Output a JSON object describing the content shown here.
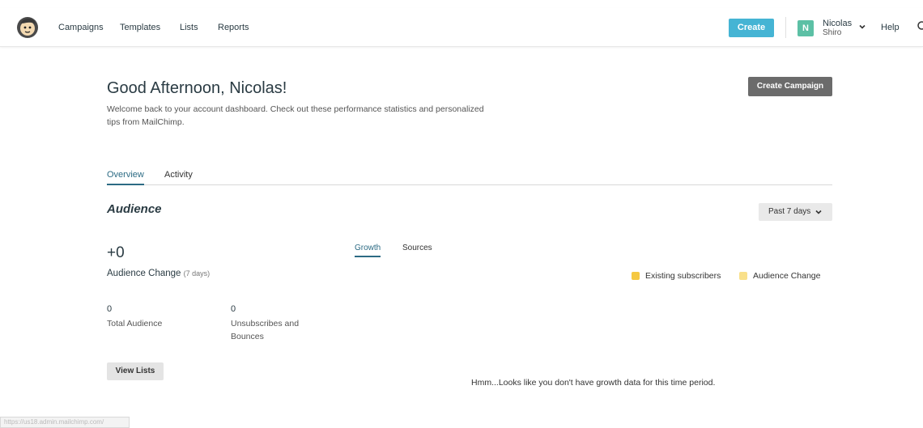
{
  "nav": {
    "items": [
      "Campaigns",
      "Templates",
      "Lists",
      "Reports"
    ],
    "create_label": "Create",
    "user_initial": "N",
    "user_first": "Nicolas",
    "user_last": "Shiro",
    "help_label": "Help"
  },
  "header": {
    "greeting": "Good Afternoon, Nicolas!",
    "welcome": "Welcome back to your account dashboard. Check out these performance statistics and personalized tips from MailChimp.",
    "create_campaign_label": "Create Campaign"
  },
  "tabs": [
    {
      "label": "Overview",
      "active": true
    },
    {
      "label": "Activity",
      "active": false
    }
  ],
  "audience": {
    "title": "Audience",
    "period": "Past 7 days",
    "change_value": "+0",
    "change_label": "Audience Change",
    "change_sub": "(7 days)",
    "total_value": "0",
    "total_label": "Total Audience",
    "unsub_value": "0",
    "unsub_label": "Unsubscribes and Bounces",
    "view_lists_label": "View Lists",
    "subtabs": [
      {
        "label": "Growth",
        "active": true
      },
      {
        "label": "Sources",
        "active": false
      }
    ],
    "legend": [
      {
        "label": "Existing subscribers",
        "color": "#f5c842"
      },
      {
        "label": "Audience Change",
        "color": "#f9e08a"
      }
    ],
    "empty_message": "Hmm...Looks like you don't have growth data for this time period."
  },
  "status_bar": {
    "url": "https://us18.admin.mailchimp.com/"
  },
  "colors": {
    "accent": "#45b4d4",
    "tab_active": "#2c6b84",
    "avatar": "#5cc0a5"
  },
  "icons": {
    "logo": "mailchimp-logo-icon",
    "user_menu": "chevron-down-icon",
    "search": "search-icon",
    "period": "chevron-down-icon"
  }
}
